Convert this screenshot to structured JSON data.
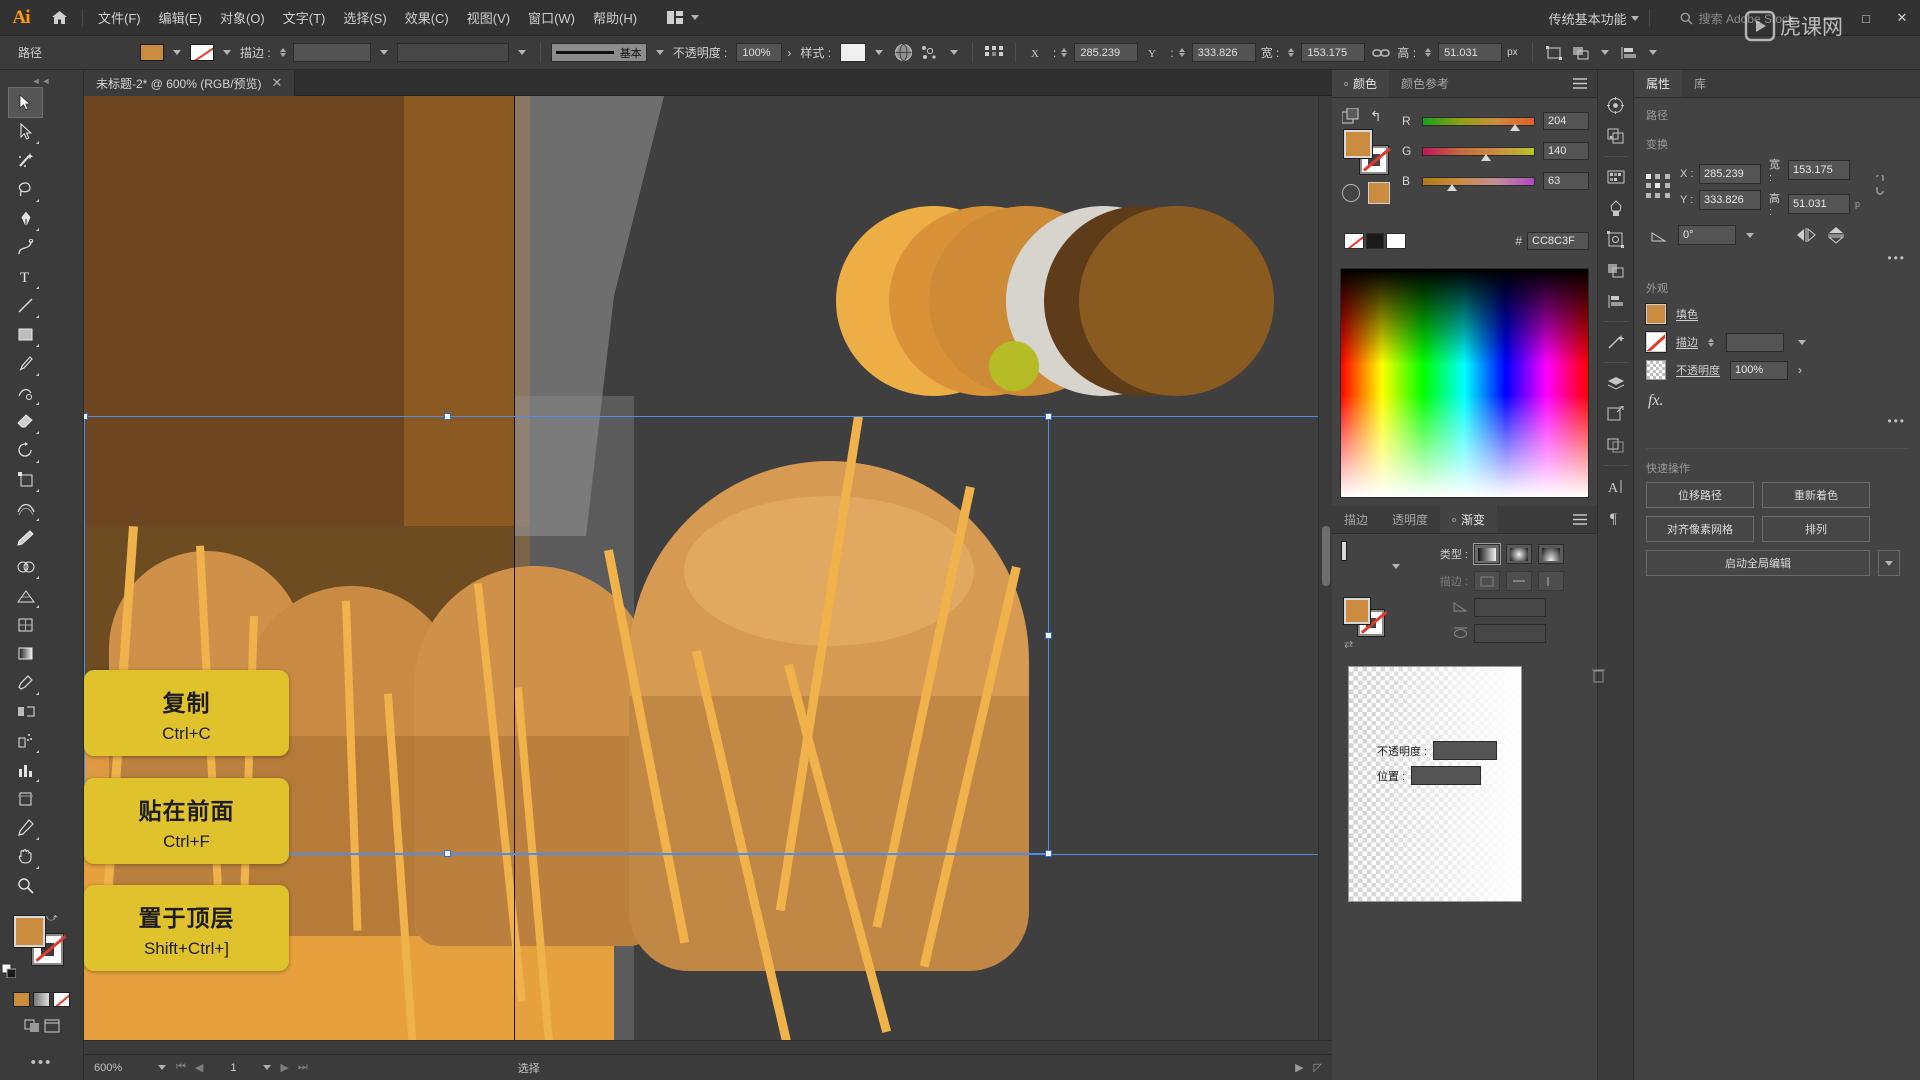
{
  "app": {
    "name": "Ai",
    "home_icon": "home-icon"
  },
  "menu": {
    "items": [
      {
        "label": "文件(F)"
      },
      {
        "label": "编辑(E)"
      },
      {
        "label": "对象(O)"
      },
      {
        "label": "文字(T)"
      },
      {
        "label": "选择(S)"
      },
      {
        "label": "效果(C)"
      },
      {
        "label": "视图(V)"
      },
      {
        "label": "窗口(W)"
      },
      {
        "label": "帮助(H)"
      }
    ],
    "arrange_icon": "arrange-documents-icon"
  },
  "topbar": {
    "workspace": "传统基本功能",
    "search_placeholder": "搜索 Adobe Stock",
    "minimize": "—",
    "maximize": "□",
    "close": "✕"
  },
  "controlbar": {
    "path_label": "路径",
    "fill_color": "#CC8C3F",
    "stroke_label": "描边 :",
    "stroke_weight": "",
    "stroke_profile_label": "基本",
    "opacity_label": "不透明度 :",
    "opacity_value": "100%",
    "style_label": "样式 :",
    "x_label": "X :",
    "x_value": "285.239",
    "y_label": "Y :",
    "y_value": "333.826",
    "w_label": "宽 :",
    "w_value": "153.175",
    "h_label": "高 :",
    "h_value": "51.031",
    "h_unit": "px",
    "link_icon": "link-ratio-icon",
    "transform_icon": "transform-icon",
    "align_icon": "align-icon",
    "arrange_icon": "arrange-icon"
  },
  "toolbar": {
    "tools": [
      {
        "name": "selection-tool",
        "glyph": "selection"
      },
      {
        "name": "direct-selection-tool",
        "glyph": "direct-selection"
      },
      {
        "name": "magic-wand-tool",
        "glyph": "magic-wand"
      },
      {
        "name": "lasso-tool",
        "glyph": "lasso"
      },
      {
        "name": "pen-tool",
        "glyph": "pen"
      },
      {
        "name": "curvature-tool",
        "glyph": "curvature"
      },
      {
        "name": "type-tool",
        "glyph": "type"
      },
      {
        "name": "line-segment-tool",
        "glyph": "line"
      },
      {
        "name": "rectangle-tool",
        "glyph": "rectangle"
      },
      {
        "name": "paintbrush-tool",
        "glyph": "paintbrush"
      },
      {
        "name": "shaper-tool",
        "glyph": "shaper"
      },
      {
        "name": "eraser-tool",
        "glyph": "eraser"
      },
      {
        "name": "rotate-tool",
        "glyph": "rotate"
      },
      {
        "name": "scale-tool",
        "glyph": "scale"
      },
      {
        "name": "width-tool",
        "glyph": "width"
      },
      {
        "name": "free-transform-tool",
        "glyph": "free-transform"
      },
      {
        "name": "shape-builder-tool",
        "glyph": "shape-builder"
      },
      {
        "name": "perspective-grid-tool",
        "glyph": "perspective"
      },
      {
        "name": "mesh-tool",
        "glyph": "mesh"
      },
      {
        "name": "gradient-tool",
        "glyph": "gradient"
      },
      {
        "name": "eyedropper-tool",
        "glyph": "eyedropper"
      },
      {
        "name": "blend-tool",
        "glyph": "blend"
      },
      {
        "name": "symbol-sprayer-tool",
        "glyph": "symbol-sprayer"
      },
      {
        "name": "column-graph-tool",
        "glyph": "column-graph"
      },
      {
        "name": "artboard-tool",
        "glyph": "artboard"
      },
      {
        "name": "slice-tool",
        "glyph": "slice"
      },
      {
        "name": "hand-tool",
        "glyph": "hand"
      },
      {
        "name": "zoom-tool",
        "glyph": "zoom"
      }
    ],
    "fill_color": "#CC8C3F",
    "stroke_color": "#FFFFFF",
    "stroke_is_none": true
  },
  "document": {
    "tab_title": "未标题-2* @ 600% (RGB/预览)",
    "close_label": "✕"
  },
  "canvas": {
    "annotations": [
      {
        "title": "复制",
        "shortcut": "Ctrl+C"
      },
      {
        "title": "贴在前面",
        "shortcut": "Ctrl+F"
      },
      {
        "title": "置于顶层",
        "shortcut": "Shift+Ctrl+]"
      }
    ],
    "artwork": {
      "palette_circles": [
        "#EDAE46",
        "#D99238",
        "#CE8B37",
        "#D6D4CD",
        "#5E3C1A",
        "#8A5B21"
      ],
      "green_dot": "#B5BC25",
      "background": "#3F3F3F",
      "brown_left": "#6D4520",
      "brown_right": "#8A5A22",
      "orange_base": "#E6A03E",
      "stalk_color": "#F0B24A"
    },
    "selection_color": "#4D8FF0"
  },
  "statusbar": {
    "zoom": "600%",
    "page": "1",
    "tool": "选择"
  },
  "color_panel": {
    "tabs": [
      {
        "label": "颜色",
        "active": true
      },
      {
        "label": "颜色参考",
        "active": false
      }
    ],
    "channels": [
      {
        "label": "R",
        "value": "204",
        "pos": 80
      },
      {
        "label": "G",
        "value": "140",
        "pos": 55
      },
      {
        "label": "B",
        "value": "63",
        "pos": 25
      }
    ],
    "hex_symbol": "#",
    "hex": "CC8C3F",
    "fill_color": "#CC8C3F",
    "menu_icon": "panel-menu-icon"
  },
  "gradient_panel": {
    "tabs": [
      {
        "label": "描边",
        "active": false
      },
      {
        "label": "透明度",
        "active": false
      },
      {
        "label": "渐变",
        "active": true
      }
    ],
    "type_label": "类型 :",
    "stroke_label": "描边 :",
    "angle_label": "角度",
    "aspect_label": "长宽比",
    "opacity_label": "不透明度 :",
    "location_label": "位置 :",
    "opacity_value": "",
    "location_value": "",
    "menu_icon": "panel-menu-icon"
  },
  "properties": {
    "tabs": [
      {
        "label": "属性",
        "active": true
      },
      {
        "label": "库",
        "active": false
      }
    ],
    "object_type": "路径",
    "transform_title": "变换",
    "x_label": "X :",
    "x_value": "285.239",
    "y_label": "Y :",
    "y_value": "333.826",
    "w_label": "宽 :",
    "w_value": "153.175",
    "h_label": "高 :",
    "h_value": "51.031",
    "h_unit": "p",
    "angle_label": "角度",
    "angle_value": "0°",
    "flip_h_icon": "flip-horizontal-icon",
    "flip_v_icon": "flip-vertical-icon",
    "more_options": "•••",
    "appearance_title": "外观",
    "fill_label": "填色",
    "stroke_label": "描边",
    "opacity_label": "不透明度",
    "opacity_value": "100%",
    "fx_label": "fx.",
    "quick_actions_title": "快速操作",
    "quick_actions": [
      {
        "label": "位移路径"
      },
      {
        "label": "重新着色"
      },
      {
        "label": "对齐像素网格"
      },
      {
        "label": "排列"
      }
    ],
    "global_edit_label": "启动全局编辑"
  },
  "icon_strip": [
    {
      "name": "color-guide-panel-icon"
    },
    {
      "name": "color-themes-panel-icon"
    },
    {
      "name": "swatches-panel-icon"
    },
    {
      "name": "brushes-panel-icon"
    },
    {
      "name": "symbols-panel-icon"
    },
    {
      "name": "transparency-panel-icon"
    },
    {
      "name": "align-panel-icon"
    },
    {
      "name": "transform-panel-icon"
    },
    {
      "name": "layers-panel-icon"
    },
    {
      "name": "artboards-panel-icon"
    },
    {
      "name": "asset-export-panel-icon"
    },
    {
      "name": "character-panel-icon"
    },
    {
      "name": "paragraph-panel-icon"
    }
  ]
}
